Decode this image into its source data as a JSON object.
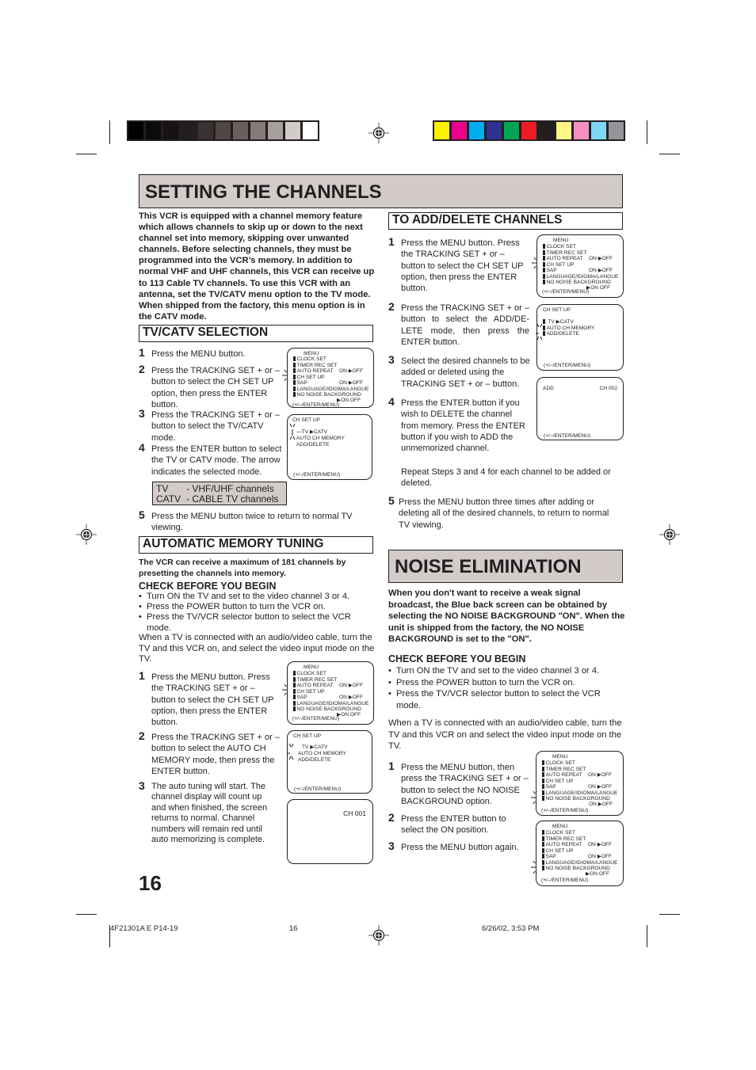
{
  "colors": {
    "title_bg": "#d3cbc9",
    "text": "#231f20",
    "grayscale_swatches": [
      "#000000",
      "#0d0b0a",
      "#171312",
      "#231f20",
      "#3a3230",
      "#514746",
      "#6b5f5c",
      "#877b79",
      "#a8a09e",
      "#d3cbc9",
      "#ffffff"
    ],
    "color_swatches": [
      "#fff200",
      "#ec008c",
      "#00aeef",
      "#2e3192",
      "#00a651",
      "#ed1c24",
      "#231f20",
      "#fff685",
      "#f68fc1",
      "#7dd8f8",
      "#939598"
    ]
  },
  "page": {
    "title": "SETTING THE CHANNELS",
    "page_number": "16",
    "intro": "This VCR is equipped with a channel memory feature which allows channels to skip up or down to the next channel set into memory, skipping over unwanted channels. Before selecting channels, they must be programmed into the VCR’s memory. In addition to normal VHF and UHF channels, this VCR can receive up to 113 Cable TV channels. To use this VCR with an antenna, set the TV/CATV menu option to the TV mode. When shipped from the factory, this menu option is in the CATV mode."
  },
  "tvcatv": {
    "heading": "TV/CATV SELECTION",
    "steps": [
      {
        "num": "1",
        "text": "Press the MENU button."
      },
      {
        "num": "2",
        "text": "Press the TRACKING SET + or – button to select the CH SET UP option, then press the ENTER button."
      },
      {
        "num": "3",
        "text": "Press the TRACKING SET + or – button to select the TV/CATV mode."
      },
      {
        "num": "4",
        "text": "Press the ENTER button to select the TV or CATV mode. The arrow indicates the selected mode."
      },
      {
        "num": "5",
        "text": "Press the MENU button twice to return to normal TV viewing."
      }
    ],
    "modes": [
      {
        "key": "TV",
        "desc": "- VHF/UHF channels"
      },
      {
        "key": "CATV",
        "desc": "- CABLE TV channels"
      }
    ]
  },
  "amt": {
    "heading": "AUTOMATIC MEMORY TUNING",
    "intro": "The VCR can receive a maximum of 181 channels by presetting the channels into memory.",
    "check_heading": "CHECK BEFORE YOU BEGIN",
    "bullets": [
      "Turn ON the TV and set to the video channel 3 or 4.",
      "Press the POWER button to turn the VCR on.",
      "Press the TV/VCR selector button to select the VCR mode."
    ],
    "note": "When a TV is connected with an audio/video cable, turn the TV and this VCR on, and select the video input mode on the TV.",
    "steps": [
      {
        "num": "1",
        "text": "Press the MENU button. Press the TRACKING SET + or – button to select the CH SET UP option, then press the ENTER button."
      },
      {
        "num": "2",
        "text": "Press the TRACKING SET + or – button to select the AUTO CH MEMORY mode, then press the ENTER button."
      },
      {
        "num": "3",
        "text": "The auto tuning will start. The channel display will count up and when finished, the screen returns to normal. Channel numbers will remain red until auto memorizing is complete."
      }
    ]
  },
  "adddel": {
    "heading": "TO ADD/DELETE CHANNELS",
    "steps": [
      {
        "num": "1",
        "text": "Press the MENU button. Press the TRACKING SET + or – button to select the CH SET UP option, then press the ENTER button."
      },
      {
        "num": "2",
        "text": "Press the TRACKING SET + or – button to select the ADD/DE-LETE mode, then press the ENTER button."
      },
      {
        "num": "3",
        "text": "Select the desired channels to be added or deleted using the TRACKING SET + or – button."
      },
      {
        "num": "4",
        "text": "Press the ENTER button if you wish to DELETE the channel from memory. Press the ENTER button if you wish to ADD the unmemorized channel."
      },
      {
        "num": "5",
        "text": "Press the MENU button three times after adding or deleting all of the desired channels, to return to normal TV viewing."
      }
    ],
    "repeat_note": "Repeat Steps 3 and 4 for each channel to be added or deleted."
  },
  "noise": {
    "title": "NOISE ELIMINATION",
    "intro": "When you don't want to receive a weak signal broadcast, the Blue back screen can be obtained by selecting the NO NOISE BACKGROUND \"ON\". When the unit is shipped from the factory, the NO NOISE BACKGROUND is set to the \"ON\".",
    "check_heading": "CHECK BEFORE YOU BEGIN",
    "bullets": [
      "Turn ON the TV and set to the video channel 3 or 4.",
      "Press the POWER button to turn the VCR on.",
      "Press the TV/VCR selector button to select the VCR mode."
    ],
    "note": "When a TV is connected with an audio/video cable, turn the TV and this VCR on and select the video input mode on the TV.",
    "steps": [
      {
        "num": "1",
        "text": "Press the MENU button, then press the TRACKING SET + or – button to select the NO NOISE BACKGROUND option."
      },
      {
        "num": "2",
        "text": "Press the ENTER button to select the ON position."
      },
      {
        "num": "3",
        "text": "Press the MENU button again."
      }
    ]
  },
  "screens": {
    "menu_title": "MENU",
    "clock_set": "CLOCK SET",
    "timer_rec_set": "TIMER REC SET",
    "auto_repeat": "AUTO REPEAT",
    "ch_set_up": "CH SET UP",
    "sap": "SAP",
    "language": "LANGUAGE/IDIOMA/LANGUE",
    "no_noise": "NO NOISE BACKGROUND",
    "on_off_a": "ON ▶OFF",
    "on_off_b": "▶ON   OFF",
    "footer": "(+/–/ENTER/MENU)",
    "chsetup_title": "CH SET UP",
    "tv_catv": "TV  ▶CATV",
    "auto_ch_memory": "AUTO CH MEMORY",
    "add_delete": "ADD/DELETE",
    "add_label": "ADD",
    "ch_002": "CH 002",
    "ch_001": "CH 001"
  },
  "footer": {
    "doc_code": "4F21301A E P14-19",
    "page": "16",
    "timestamp": "6/26/02, 3:53 PM"
  }
}
